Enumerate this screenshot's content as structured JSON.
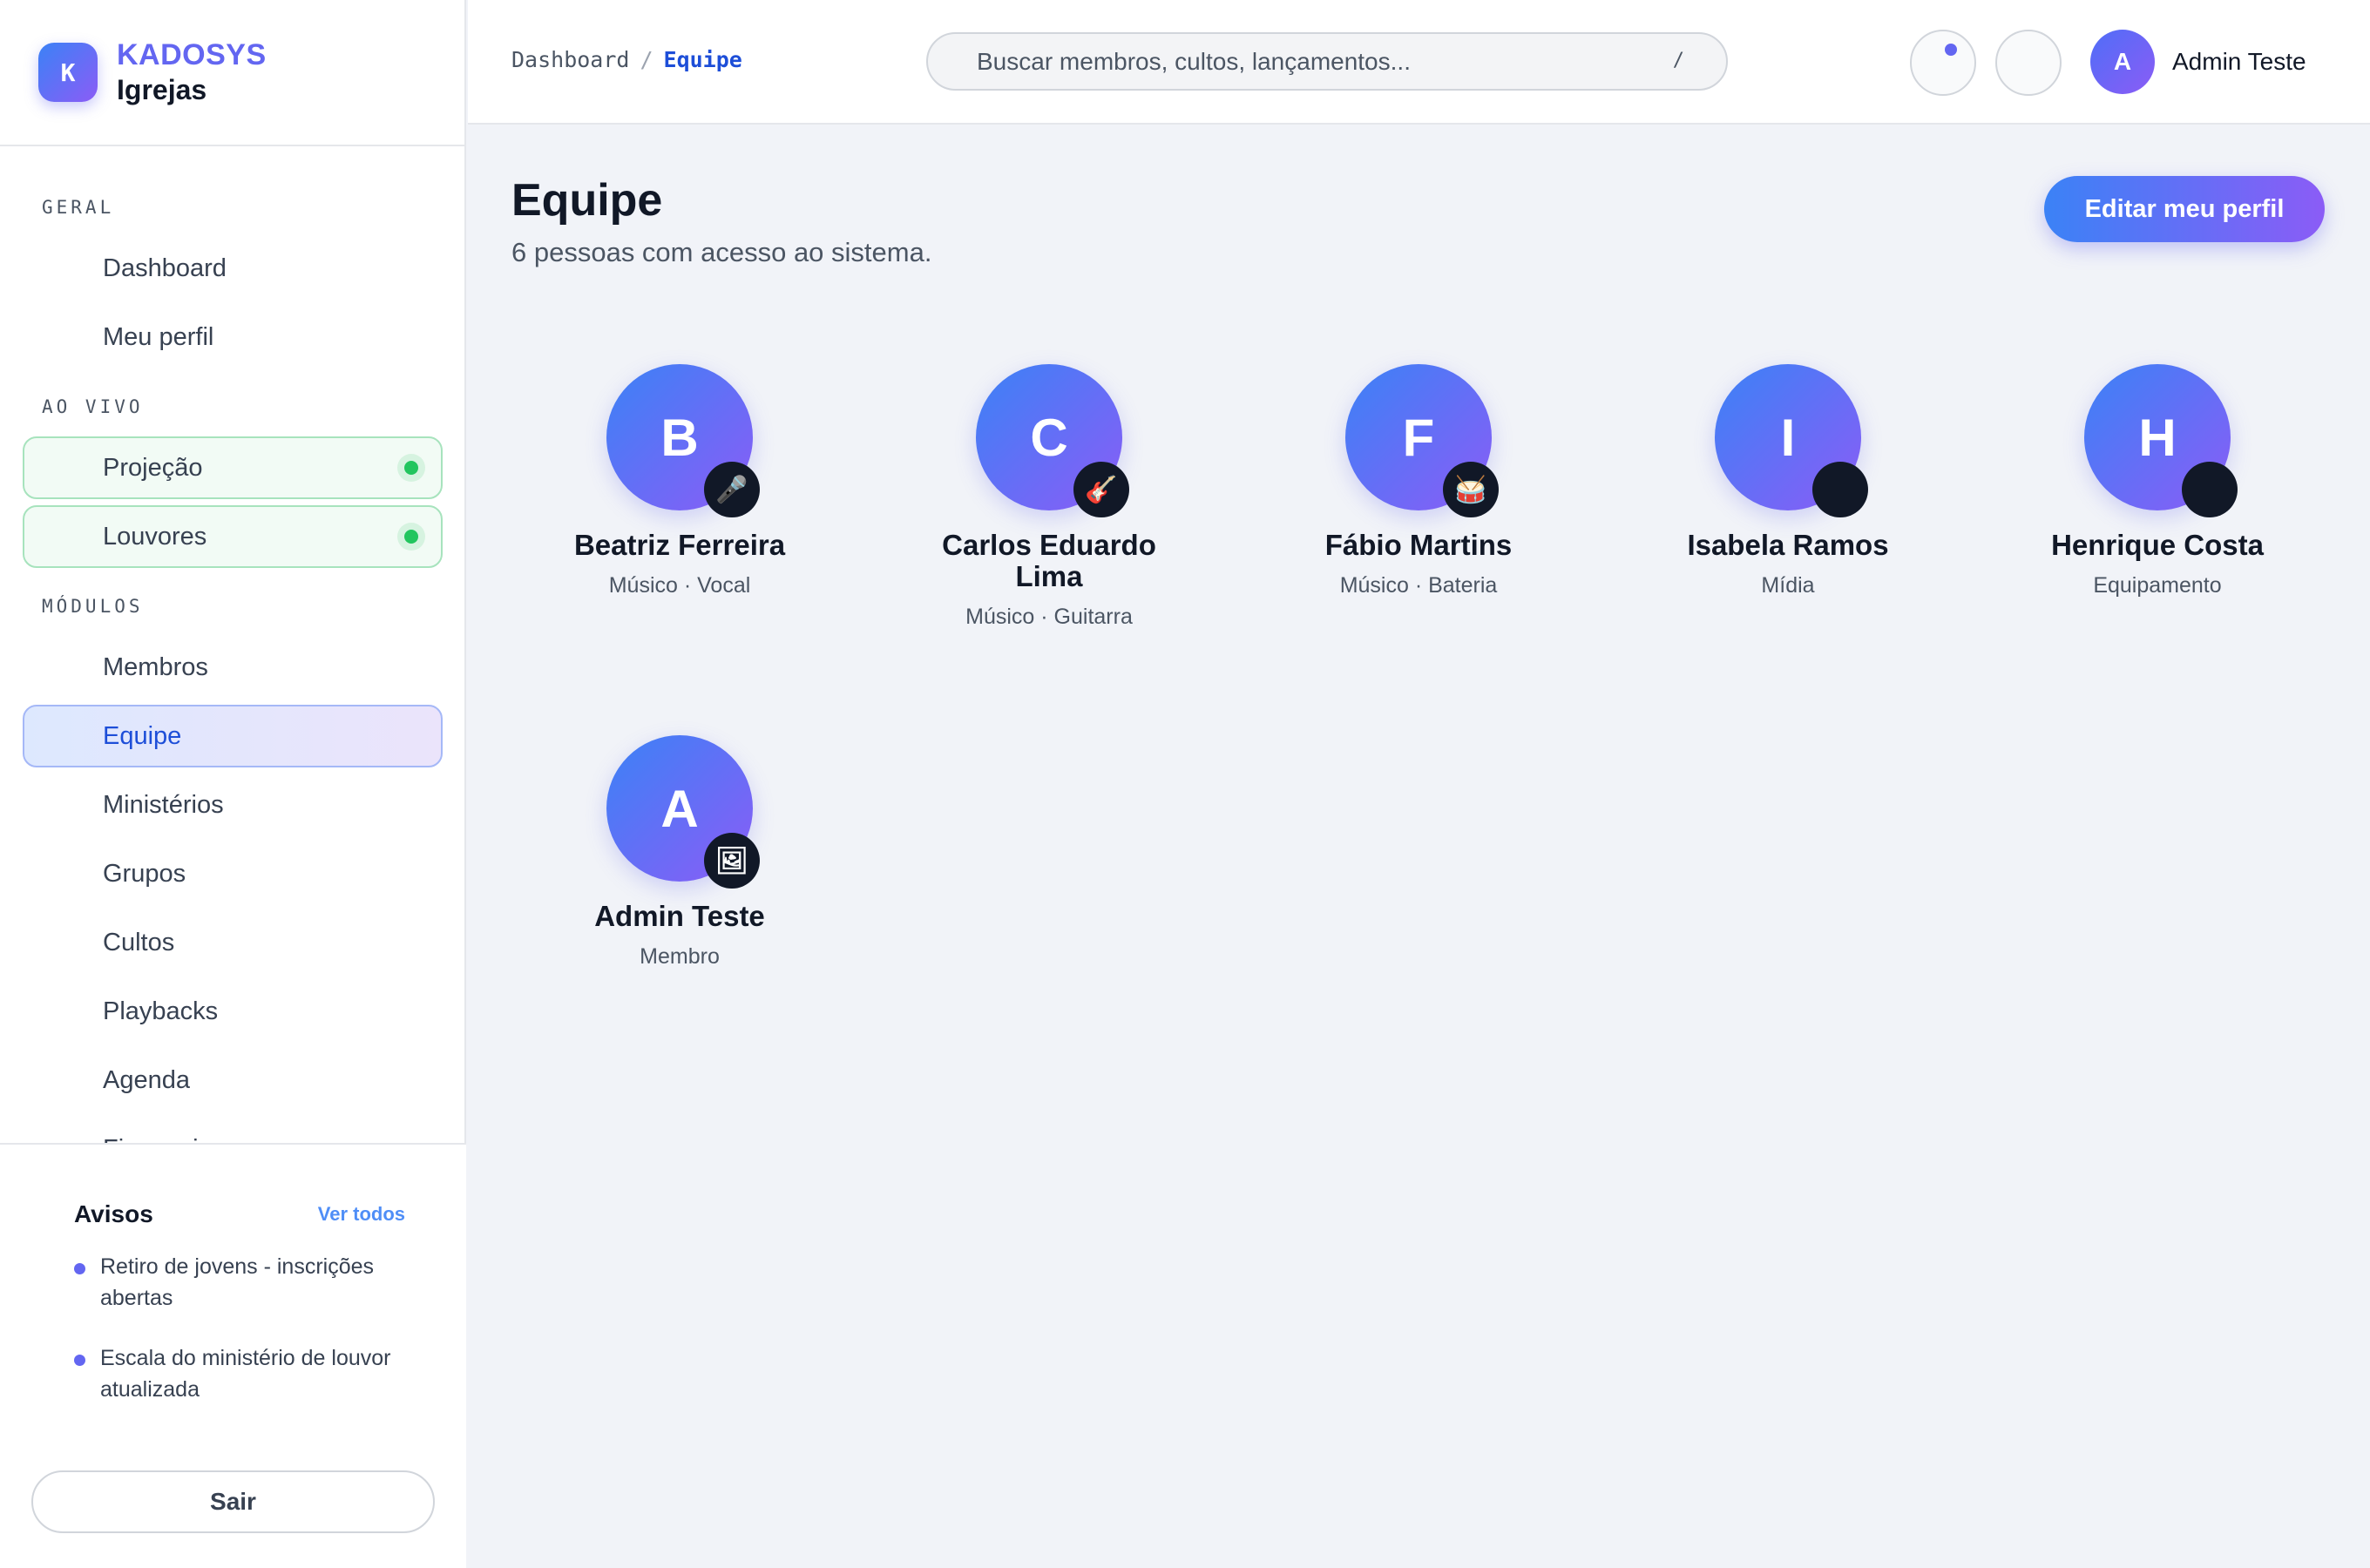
{
  "brand": {
    "logo_letter": "K",
    "name": "KADOSYS",
    "subtitle": "Igrejas"
  },
  "sidebar": {
    "sections": [
      {
        "title": "GERAL",
        "items": [
          {
            "label": "Dashboard"
          },
          {
            "label": "Meu perfil"
          }
        ]
      },
      {
        "title": "AO VIVO",
        "items": [
          {
            "label": "Projeção",
            "live": true
          },
          {
            "label": "Louvores",
            "live": true
          }
        ]
      },
      {
        "title": "MÓDULOS",
        "items": [
          {
            "label": "Membros"
          },
          {
            "label": "Equipe",
            "active": true
          },
          {
            "label": "Ministérios"
          },
          {
            "label": "Grupos"
          },
          {
            "label": "Cultos"
          },
          {
            "label": "Playbacks"
          },
          {
            "label": "Agenda"
          },
          {
            "label": "Financeiro"
          }
        ]
      }
    ]
  },
  "notices": {
    "title": "Avisos",
    "link": "Ver todos",
    "items": [
      {
        "text": "Retiro de jovens - inscrições abertas"
      },
      {
        "text": "Escala do ministério de louvor atualizada"
      }
    ]
  },
  "logout_label": "Sair",
  "breadcrumb": {
    "parent": "Dashboard",
    "separator": "/",
    "current": "Equipe"
  },
  "search": {
    "placeholder": "Buscar membros, cultos, lançamentos...",
    "shortcut": "/"
  },
  "user": {
    "initial": "A",
    "name": "Admin Teste"
  },
  "page": {
    "title": "Equipe",
    "subtitle": "6 pessoas com acesso ao sistema.",
    "edit_button": "Editar meu perfil"
  },
  "members": [
    {
      "initial": "B",
      "name": "Beatriz Ferreira",
      "role": "Músico · Vocal",
      "badge": "🎤",
      "badge_icon": "microphone-icon"
    },
    {
      "initial": "C",
      "name": "Carlos Eduardo Lima",
      "role": "Músico · Guitarra",
      "badge": "🎸",
      "badge_icon": "guitar-icon"
    },
    {
      "initial": "F",
      "name": "Fábio Martins",
      "role": "Músico · Bateria",
      "badge": "🥁",
      "badge_icon": "drum-icon"
    },
    {
      "initial": "I",
      "name": "Isabela Ramos",
      "role": "Mídia",
      "badge": "",
      "badge_icon": "media-badge-icon"
    },
    {
      "initial": "H",
      "name": "Henrique Costa",
      "role": "Equipamento",
      "badge": "",
      "badge_icon": "equipment-badge-icon"
    },
    {
      "initial": "A",
      "name": "Admin Teste",
      "role": "Membro",
      "badge": "🖼",
      "badge_icon": "picture-icon"
    }
  ],
  "colors": {
    "accent": "#6366f1",
    "live": "#22c55e",
    "active_text": "#1d4ed8"
  }
}
